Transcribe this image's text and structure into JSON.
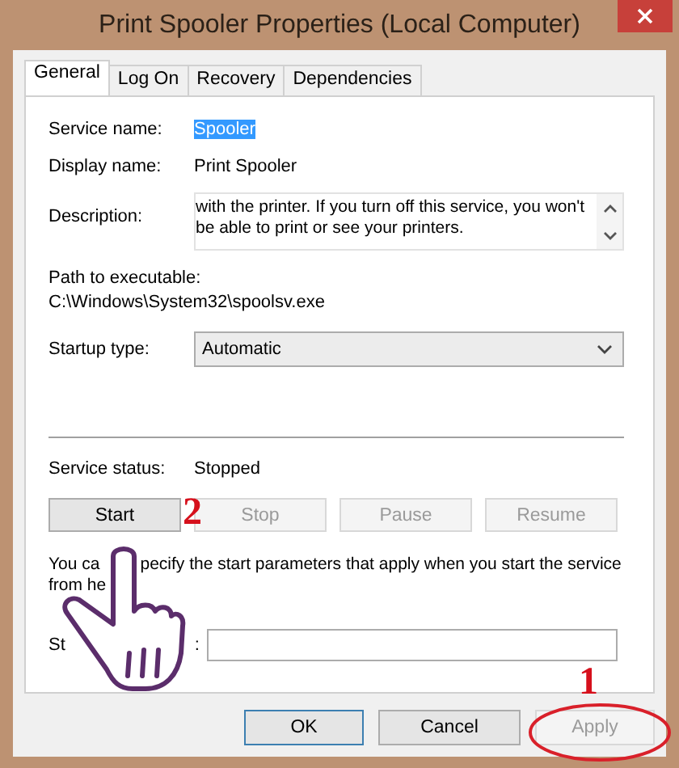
{
  "window": {
    "title": "Print Spooler Properties (Local Computer)"
  },
  "tabs": [
    {
      "label": "General",
      "selected": true
    },
    {
      "label": "Log On",
      "selected": false
    },
    {
      "label": "Recovery",
      "selected": false
    },
    {
      "label": "Dependencies",
      "selected": false
    }
  ],
  "service_name": {
    "label": "Service name:",
    "value": "Spooler",
    "selected": true
  },
  "display_name": {
    "label": "Display name:",
    "value": "Print Spooler"
  },
  "description": {
    "label": "Description:",
    "lines": [
      "with the printer.  If you turn off this service, you won't",
      "be able to print or see your printers."
    ]
  },
  "path": {
    "label": "Path to executable:",
    "value": "C:\\Windows\\System32\\spoolsv.exe"
  },
  "startup_type": {
    "label": "Startup type:",
    "value": "Automatic"
  },
  "service_status": {
    "label": "Service status:",
    "value": "Stopped"
  },
  "service_buttons": [
    {
      "label": "Start",
      "disabled": false
    },
    {
      "label": "Stop",
      "disabled": true
    },
    {
      "label": "Pause",
      "disabled": true
    },
    {
      "label": "Resume",
      "disabled": true
    }
  ],
  "hint": {
    "line_1_parts": [
      "You ca",
      "pecify the start parameters that apply when you start the service"
    ],
    "line_2": "from he"
  },
  "start_parameters": {
    "label_parts": [
      "St",
      ":"
    ]
  },
  "dialog_buttons": [
    {
      "label": "OK",
      "disabled": false,
      "default": true
    },
    {
      "label": "Cancel",
      "disabled": false,
      "default": false
    },
    {
      "label": "Apply",
      "disabled": true,
      "default": false
    }
  ],
  "annotations": [
    {
      "kind": "step",
      "text": "2"
    },
    {
      "kind": "step",
      "text": "1"
    }
  ]
}
